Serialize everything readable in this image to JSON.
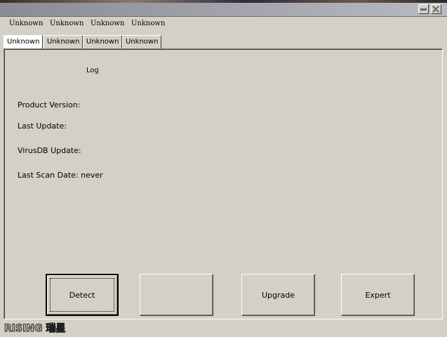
{
  "menu": [
    "Unknown",
    "Unknown",
    "Unknown",
    "Unknown"
  ],
  "tabs": [
    "Unknown",
    "Unknown",
    "Unknown",
    "Unknown"
  ],
  "active_tab_index": 0,
  "panel": {
    "log_label": "Log",
    "product_version": "Product Version:",
    "last_update": "Last Update:",
    "virusdb_update": "VirusDB Update:",
    "last_scan_date": "Last Scan Date: never"
  },
  "buttons": {
    "detect": "Detect",
    "blank": "",
    "upgrade": "Upgrade",
    "expert": "Expert"
  },
  "brand": {
    "logo_text": "RISING 瑞星"
  }
}
